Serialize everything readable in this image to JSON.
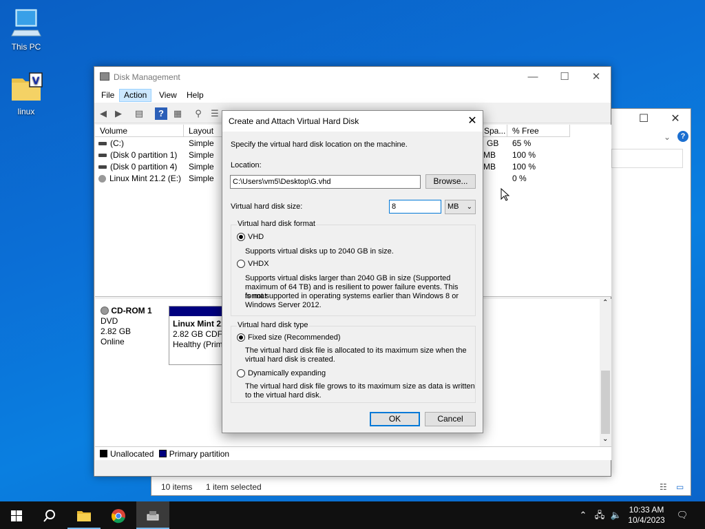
{
  "desktop": {
    "icons": [
      {
        "label": "This PC"
      },
      {
        "label": "linux"
      }
    ]
  },
  "explorer": {
    "status_items": "10 items",
    "status_selected": "1 item selected"
  },
  "disk_management": {
    "title": "Disk Management",
    "menu": [
      "File",
      "Action",
      "View",
      "Help"
    ],
    "columns": {
      "volume": "Volume",
      "layout": "Layout",
      "free_space": "Spa...",
      "pct_free": "% Free"
    },
    "volumes": [
      {
        "name": "(C:)",
        "layout": "Simple",
        "free": "GB",
        "pct": "65 %"
      },
      {
        "name": "(Disk 0 partition 1)",
        "layout": "Simple",
        "free": "MB",
        "pct": "100 %"
      },
      {
        "name": "(Disk 0 partition 4)",
        "layout": "Simple",
        "free": "MB",
        "pct": "100 %"
      },
      {
        "name": "Linux Mint 21.2 (E:)",
        "layout": "Simple",
        "free": "",
        "pct": "0 %"
      }
    ],
    "cdrom": {
      "name": "CD-ROM 1",
      "type": "DVD",
      "size": "2.82 GB",
      "status": "Online",
      "partition_name": "Linux Mint 21",
      "partition_size": "2.82 GB CDFS",
      "partition_health": "Healthy (Prim"
    },
    "legend": {
      "unallocated": "Unallocated",
      "primary": "Primary partition"
    }
  },
  "dialog": {
    "title": "Create and Attach Virtual Hard Disk",
    "instruction": "Specify the virtual hard disk location on the machine.",
    "location_label": "Location:",
    "location_value": "C:\\Users\\vm5\\Desktop\\G.vhd",
    "browse_label": "Browse...",
    "size_label": "Virtual hard disk size:",
    "size_value": "8",
    "size_unit": "MB",
    "format_group": "Virtual hard disk format",
    "vhd_label": "VHD",
    "vhd_desc": "Supports virtual disks up to 2040 GB in size.",
    "vhdx_label": "VHDX",
    "vhdx_desc_1": "Supports virtual disks larger than 2040 GB in size (Supported",
    "vhdx_desc_2": "maximum of 64 TB) and is resilient to power failure events. This format",
    "vhdx_desc_3": "is not supported in operating systems earlier than Windows 8 or",
    "vhdx_desc_4": "Windows Server 2012.",
    "type_group": "Virtual hard disk type",
    "fixed_label": "Fixed size (Recommended)",
    "fixed_desc_1": "The virtual hard disk file is allocated to its maximum size when the",
    "fixed_desc_2": "virtual hard disk is created.",
    "dynamic_label": "Dynamically expanding",
    "dynamic_desc_1": "The virtual hard disk file grows to its maximum size as data is written",
    "dynamic_desc_2": "to the virtual hard disk.",
    "ok_label": "OK",
    "cancel_label": "Cancel"
  },
  "taskbar": {
    "time": "10:33 AM",
    "date": "10/4/2023"
  },
  "colors": {
    "accent": "#0078d7",
    "primary_partition": "#00007f",
    "desktop": "#0a6fd6"
  }
}
